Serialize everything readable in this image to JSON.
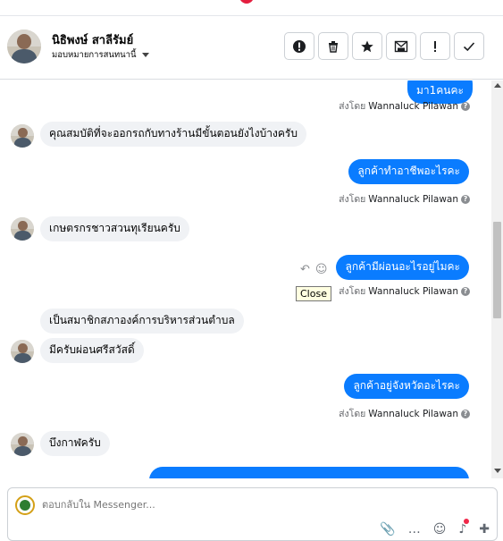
{
  "header": {
    "name": "นิธิพงษ์ สาลีรัมย์",
    "assign_label": "มอบหมายการสนทนานี้",
    "actions": [
      "!",
      "🗑",
      "★",
      "✉",
      "!",
      "✓"
    ]
  },
  "messages": [
    {
      "dir": "out",
      "text": "มา1คนคะ"
    },
    {
      "dir": "meta",
      "prefix": "ส่งโดย",
      "by": "Wannaluck Pilawan"
    },
    {
      "dir": "in",
      "text": "คุณสมบัติที่จะออกรถกับทางร้านมีขั้นตอนยังไงบ้างครับ"
    },
    {
      "dir": "out",
      "text": "ลูกค้าทำอาชีพอะไรคะ"
    },
    {
      "dir": "meta",
      "prefix": "ส่งโดย",
      "by": "Wannaluck Pilawan"
    },
    {
      "dir": "in",
      "text": "เกษตรกรชาวสวนทุเรียนครับ"
    },
    {
      "dir": "out",
      "text": "ลูกค้ามีผ่อนอะไรอยู่ไมคะ"
    },
    {
      "dir": "meta",
      "prefix": "ส่งโดย",
      "by": "Wannaluck Pilawan"
    },
    {
      "dir": "in",
      "text": "เป็นสมาชิกสภาองค์การบริหารส่วนตำบล"
    },
    {
      "dir": "in",
      "text": "มีครับผ่อนศรีสวัสดิ์"
    },
    {
      "dir": "out",
      "text": "ลูกค้าอยู่จังหวัดอะไรคะ"
    },
    {
      "dir": "meta",
      "prefix": "ส่งโดย",
      "by": "Wannaluck Pilawan"
    },
    {
      "dir": "in",
      "text": "บึงกาฬครับ"
    }
  ],
  "tooltip": "Close",
  "composer": {
    "placeholder": "ตอบกลับใน Messenger..."
  },
  "colors": {
    "outgoing": "#0a7cff",
    "incoming": "#f0f2f5"
  }
}
